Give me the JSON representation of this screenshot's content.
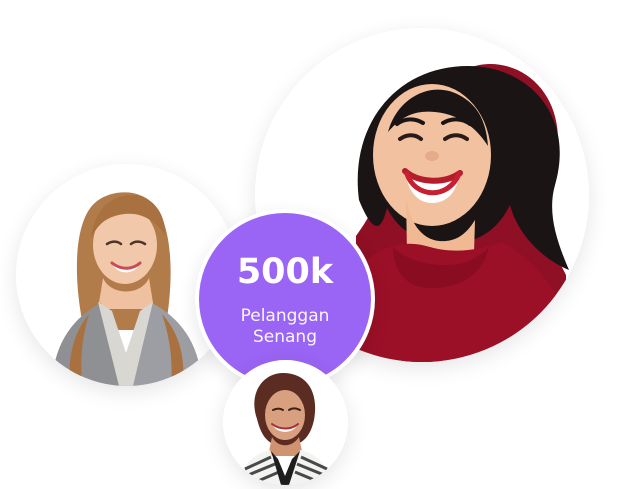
{
  "stat": {
    "value": "500k",
    "caption_line1": "Pelanggan",
    "caption_line2": "Senang"
  },
  "colors": {
    "badge": "#9a64f4",
    "badge_text": "#ffffff",
    "background": "#ffffff"
  },
  "photos": {
    "large": "laughing-woman-red-sweater-photo",
    "left": "smiling-woman-gray-blazer-photo",
    "small": "smiling-woman-striped-jacket-photo"
  }
}
